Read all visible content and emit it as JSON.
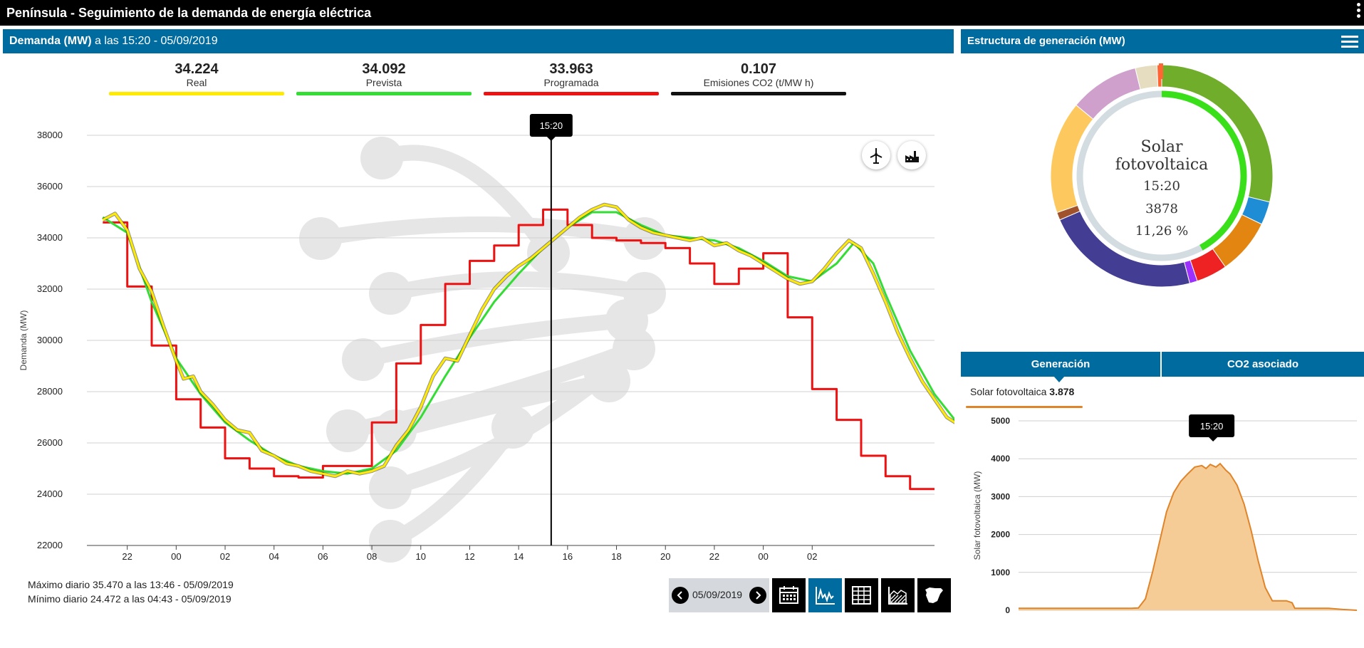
{
  "app": {
    "title": "Península  -  Seguimiento de la demanda de energía eléctrica"
  },
  "left_panel": {
    "title_bold": "Demanda (MW)",
    "title_rest": " a las 15:20 - 05/09/2019"
  },
  "kpis": [
    {
      "value": "34.224",
      "label": "Real",
      "color": "#ffea00"
    },
    {
      "value": "34.092",
      "label": "Prevista",
      "color": "#33dd33"
    },
    {
      "value": "33.963",
      "label": "Programada",
      "color": "#ee1111"
    },
    {
      "value": "0.107",
      "label": "Emisiones CO2 (t/MW h)",
      "color": "#111111"
    }
  ],
  "chart_data": [
    {
      "type": "line",
      "ylabel": "Demanda (MW)",
      "xlabel": "",
      "ylim": [
        22000,
        38000
      ],
      "yticks": [
        "22000",
        "24000",
        "26000",
        "28000",
        "30000",
        "32000",
        "34000",
        "36000",
        "38000"
      ],
      "x_tick_labels": [
        "22",
        "00",
        "02",
        "04",
        "06",
        "08",
        "10",
        "12",
        "14",
        "16",
        "18",
        "20",
        "22",
        "00",
        "02"
      ],
      "cursor_label": "15:20",
      "grid": true,
      "series": [
        {
          "name": "Real",
          "color": "#ffea00",
          "points": [
            [
              21,
              34700
            ],
            [
              21.5,
              34950
            ],
            [
              22,
              34300
            ],
            [
              22.5,
              32800
            ],
            [
              23,
              31900
            ],
            [
              23.5,
              30500
            ],
            [
              24,
              29200
            ],
            [
              24.3,
              28500
            ],
            [
              24.7,
              28600
            ],
            [
              25,
              28000
            ],
            [
              25.5,
              27500
            ],
            [
              26,
              26900
            ],
            [
              26.5,
              26500
            ],
            [
              27,
              26400
            ],
            [
              27.5,
              25700
            ],
            [
              28,
              25500
            ],
            [
              28.5,
              25200
            ],
            [
              29,
              25100
            ],
            [
              29.5,
              24900
            ],
            [
              30,
              24800
            ],
            [
              30.5,
              24700
            ],
            [
              31,
              24900
            ],
            [
              31.5,
              24800
            ],
            [
              32,
              24900
            ],
            [
              32.5,
              25100
            ],
            [
              33,
              25900
            ],
            [
              33.5,
              26500
            ],
            [
              34,
              27400
            ],
            [
              34.5,
              28600
            ],
            [
              35,
              29300
            ],
            [
              35.5,
              29200
            ],
            [
              36,
              30200
            ],
            [
              36.5,
              31200
            ],
            [
              37,
              32000
            ],
            [
              37.5,
              32500
            ],
            [
              38,
              32900
            ],
            [
              38.5,
              33200
            ],
            [
              39,
              33600
            ],
            [
              39.5,
              34000
            ],
            [
              40,
              34400
            ],
            [
              40.5,
              34800
            ],
            [
              41,
              35100
            ],
            [
              41.5,
              35300
            ],
            [
              42,
              35200
            ],
            [
              42.5,
              34700
            ],
            [
              43,
              34400
            ],
            [
              43.5,
              34200
            ],
            [
              44,
              34100
            ],
            [
              44.5,
              34000
            ],
            [
              45,
              33900
            ],
            [
              45.5,
              34000
            ],
            [
              46,
              33700
            ],
            [
              46.5,
              33800
            ],
            [
              47,
              33500
            ],
            [
              47.5,
              33300
            ],
            [
              48,
              33000
            ],
            [
              48.5,
              32700
            ],
            [
              49,
              32400
            ],
            [
              49.5,
              32200
            ],
            [
              50,
              32300
            ],
            [
              50.5,
              32800
            ],
            [
              51,
              33400
            ],
            [
              51.5,
              33900
            ],
            [
              52,
              33600
            ],
            [
              52.5,
              32600
            ],
            [
              53,
              31500
            ],
            [
              53.5,
              30300
            ],
            [
              54,
              29300
            ],
            [
              54.5,
              28400
            ],
            [
              55,
              27700
            ],
            [
              55.5,
              27000
            ],
            [
              56,
              26700
            ],
            [
              56.5,
              26200
            ],
            [
              57,
              25800
            ],
            [
              57.5,
              25400
            ],
            [
              58,
              25100
            ],
            [
              58.5,
              24800
            ],
            [
              59,
              24700
            ],
            [
              59.5,
              24500
            ]
          ]
        },
        {
          "name": "Prevista",
          "color": "#33dd33",
          "points": [
            [
              21,
              34800
            ],
            [
              22,
              34200
            ],
            [
              23,
              31500
            ],
            [
              24,
              29300
            ],
            [
              25,
              27900
            ],
            [
              26,
              26800
            ],
            [
              27,
              26100
            ],
            [
              28,
              25500
            ],
            [
              29,
              25100
            ],
            [
              30,
              24900
            ],
            [
              31,
              24800
            ],
            [
              32,
              25000
            ],
            [
              33,
              25700
            ],
            [
              34,
              27000
            ],
            [
              35,
              28600
            ],
            [
              36,
              30100
            ],
            [
              37,
              31500
            ],
            [
              38,
              32600
            ],
            [
              39,
              33600
            ],
            [
              40,
              34400
            ],
            [
              41,
              35000
            ],
            [
              42,
              35000
            ],
            [
              43,
              34500
            ],
            [
              44,
              34100
            ],
            [
              45,
              34000
            ],
            [
              46,
              33900
            ],
            [
              47,
              33600
            ],
            [
              48,
              33100
            ],
            [
              49,
              32500
            ],
            [
              50,
              32300
            ],
            [
              51,
              33000
            ],
            [
              51.7,
              33800
            ],
            [
              52.5,
              33000
            ],
            [
              53,
              31800
            ],
            [
              54,
              29600
            ],
            [
              55,
              27900
            ],
            [
              56,
              26700
            ],
            [
              57,
              25900
            ],
            [
              58,
              25200
            ],
            [
              59,
              24700
            ],
            [
              60,
              24500
            ],
            [
              61,
              24300
            ]
          ]
        },
        {
          "name": "Programada",
          "color": "#ee1111",
          "points": [
            [
              21,
              34600
            ],
            [
              22,
              34600
            ],
            [
              22,
              32100
            ],
            [
              23,
              32100
            ],
            [
              23,
              29800
            ],
            [
              24,
              29800
            ],
            [
              24,
              27700
            ],
            [
              25,
              27700
            ],
            [
              25,
              26600
            ],
            [
              26,
              26600
            ],
            [
              26,
              25400
            ],
            [
              27,
              25400
            ],
            [
              27,
              25000
            ],
            [
              28,
              25000
            ],
            [
              28,
              24700
            ],
            [
              29,
              24700
            ],
            [
              29,
              24650
            ],
            [
              30,
              24650
            ],
            [
              30,
              25100
            ],
            [
              31,
              25100
            ],
            [
              31,
              25100
            ],
            [
              32,
              25100
            ],
            [
              32,
              26800
            ],
            [
              33,
              26800
            ],
            [
              33,
              29100
            ],
            [
              34,
              29100
            ],
            [
              34,
              30600
            ],
            [
              35,
              30600
            ],
            [
              35,
              32200
            ],
            [
              36,
              32200
            ],
            [
              36,
              33100
            ],
            [
              37,
              33100
            ],
            [
              37,
              33700
            ],
            [
              38,
              33700
            ],
            [
              38,
              34500
            ],
            [
              39,
              34500
            ],
            [
              39,
              35100
            ],
            [
              40,
              35100
            ],
            [
              40,
              34500
            ],
            [
              41,
              34500
            ],
            [
              41,
              34000
            ],
            [
              42,
              34000
            ],
            [
              42,
              33900
            ],
            [
              43,
              33900
            ],
            [
              43,
              33800
            ],
            [
              44,
              33800
            ],
            [
              44,
              33600
            ],
            [
              45,
              33600
            ],
            [
              45,
              33000
            ],
            [
              46,
              33000
            ],
            [
              46,
              32200
            ],
            [
              47,
              32200
            ],
            [
              47,
              32800
            ],
            [
              48,
              32800
            ],
            [
              48,
              33400
            ],
            [
              49,
              33400
            ],
            [
              49,
              30900
            ],
            [
              50,
              30900
            ],
            [
              50,
              28100
            ],
            [
              51,
              28100
            ],
            [
              51,
              26900
            ],
            [
              52,
              26900
            ],
            [
              52,
              25500
            ],
            [
              53,
              25500
            ],
            [
              53,
              24700
            ],
            [
              54,
              24700
            ],
            [
              54,
              24200
            ],
            [
              55,
              24200
            ]
          ]
        }
      ],
      "x_range": [
        20.35,
        55
      ],
      "x_ticks_hours": [
        22,
        24,
        26,
        28,
        30,
        32,
        34,
        36,
        38,
        40,
        42,
        44,
        46,
        48,
        50
      ],
      "cursor_x": 39.33
    },
    {
      "type": "pie",
      "title": "Estructura de generación (MW)",
      "center_labels": [
        "Solar",
        "fotovoltaica",
        "15:20",
        "3878",
        "11,26 %"
      ],
      "selected_series": "Solar fotovoltaica",
      "slices": [
        {
          "value": 25.5,
          "color": "#6fad2a"
        },
        {
          "value": 3.0,
          "color": "#1f8dd6"
        },
        {
          "value": 7.2,
          "color": "#e28511"
        },
        {
          "value": 4.0,
          "color": "#ee2222"
        },
        {
          "value": 1.0,
          "color": "#9b30ff"
        },
        {
          "value": 20.0,
          "color": "#433e94"
        },
        {
          "value": 1.0,
          "color": "#a0522d"
        },
        {
          "value": 14.5,
          "color": "#fdc95e"
        },
        {
          "value": 9.0,
          "color": "#cfa0cc"
        },
        {
          "value": 2.8,
          "color": "#e6dcc0"
        },
        {
          "value": 0.6,
          "color": "#ff6633"
        }
      ],
      "inner_value_pct": 11.26
    },
    {
      "type": "area",
      "ylabel": "Solar fotovoltaica (MW)",
      "ylim": [
        0,
        5000
      ],
      "yticks": [
        "0",
        "1000",
        "2000",
        "3000",
        "4000",
        "5000"
      ],
      "cursor_label": "15:20",
      "color": "#e0842a",
      "fill": "#f5cc95",
      "x_range": [
        0,
        24
      ],
      "points": [
        [
          0,
          50
        ],
        [
          2,
          50
        ],
        [
          4,
          50
        ],
        [
          6,
          50
        ],
        [
          8,
          50
        ],
        [
          8.5,
          60
        ],
        [
          9,
          300
        ],
        [
          9.5,
          1000
        ],
        [
          10,
          1800
        ],
        [
          10.5,
          2600
        ],
        [
          11,
          3100
        ],
        [
          11.5,
          3400
        ],
        [
          12,
          3600
        ],
        [
          12.5,
          3780
        ],
        [
          13,
          3820
        ],
        [
          13.3,
          3740
        ],
        [
          13.6,
          3850
        ],
        [
          14,
          3780
        ],
        [
          14.3,
          3870
        ],
        [
          14.7,
          3700
        ],
        [
          15,
          3600
        ],
        [
          15.5,
          3300
        ],
        [
          16,
          2800
        ],
        [
          16.5,
          2100
        ],
        [
          17,
          1300
        ],
        [
          17.5,
          600
        ],
        [
          18,
          250
        ],
        [
          19,
          250
        ],
        [
          19.4,
          200
        ],
        [
          19.6,
          50
        ],
        [
          22,
          50
        ],
        [
          23,
          20
        ],
        [
          24,
          0
        ]
      ]
    }
  ],
  "stats": {
    "max": "Máximo diario 35.470 a las 13:46 - 05/09/2019",
    "min": "Mínimo diario 24.472 a las 04:43 - 05/09/2019"
  },
  "date_nav": {
    "date": "05/09/2019"
  },
  "toolbar_icons": [
    "calendar-icon",
    "demand-chart-icon",
    "table-icon",
    "generation-icon",
    "spain-map-icon"
  ],
  "right_panel": {
    "title": "Estructura de generación (MW)"
  },
  "tabs": [
    {
      "label": "Generación"
    },
    {
      "label": "CO2 asociado"
    }
  ],
  "selection": {
    "name": "Solar fotovoltaica ",
    "value": "3.878"
  }
}
